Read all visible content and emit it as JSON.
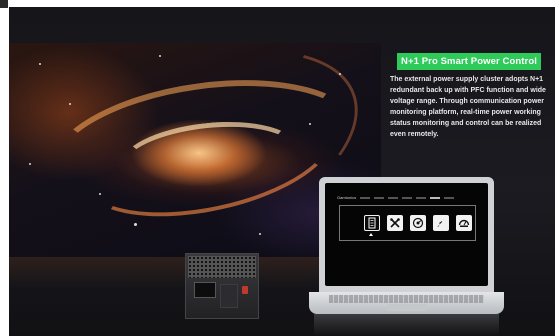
{
  "heading": "N+1 Pro Smart Power Control",
  "description": "The external power supply cluster adopts N+1 redundant back up with PFC function and wide voltage range. Through communication power monitoring platform, real-time power working status monitoring and control can be realized even remotely.",
  "laptop_screen": {
    "app_name": "Gamtonics",
    "selected_icon": "server-icon",
    "icons": [
      "server-icon",
      "tools-icon",
      "dashboard-icon",
      "rocket-icon",
      "gauge-icon"
    ]
  },
  "colors": {
    "accent": "#2ecb5b",
    "background": "#1b1b21",
    "text": "#e8e8e8"
  }
}
